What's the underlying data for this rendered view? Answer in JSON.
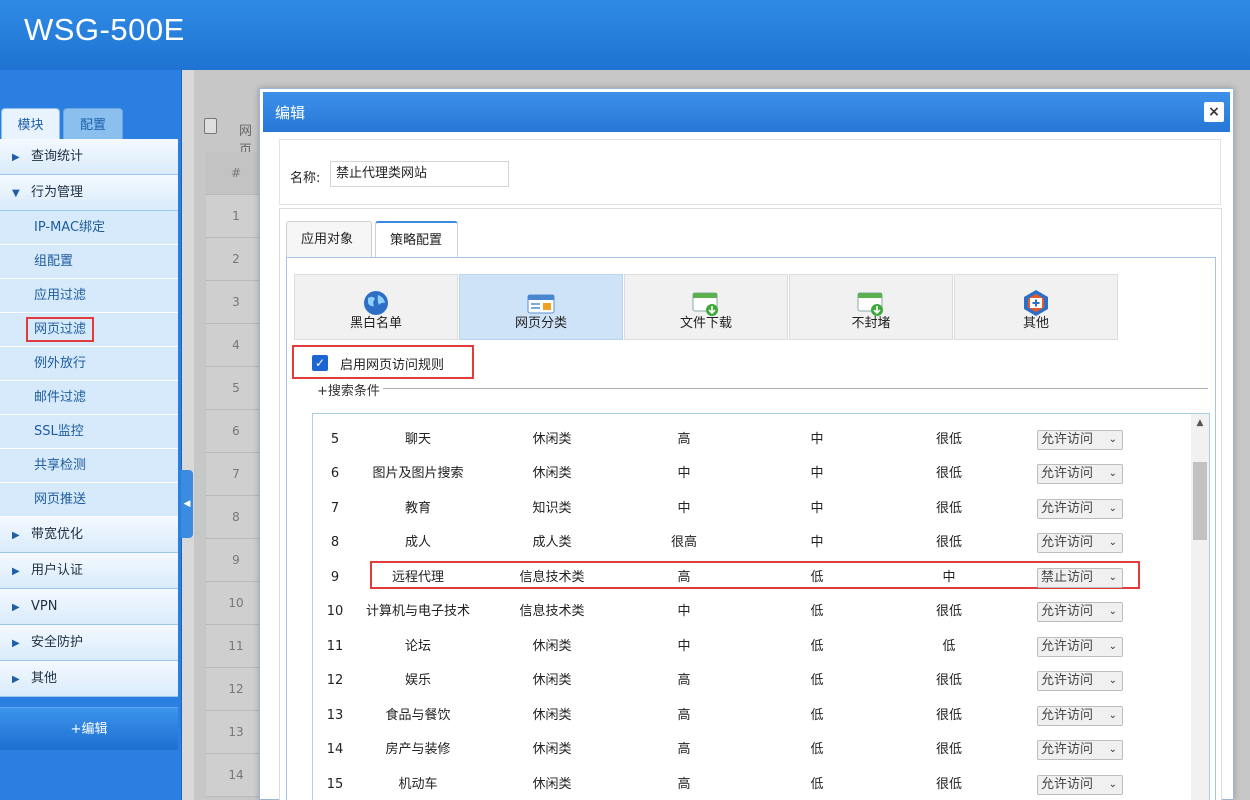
{
  "header": {
    "product": "WSG-500E"
  },
  "sidebar": {
    "tabs": [
      "模块",
      "配置"
    ],
    "menu": [
      {
        "label": "查询统计",
        "expanded": false
      },
      {
        "label": "行为管理",
        "expanded": true
      }
    ],
    "submenu": [
      "IP-MAC绑定",
      "组配置",
      "应用过滤",
      "网页过滤",
      "例外放行",
      "邮件过滤",
      "SSL监控",
      "共享检测",
      "网页推送"
    ],
    "menu_rest": [
      "带宽优化",
      "用户认证",
      "VPN",
      "安全防护",
      "其他"
    ],
    "edit_button": "+编辑",
    "active_submenu": "网页过滤"
  },
  "background": {
    "toolbar_text": "网页",
    "head": "#",
    "rows": [
      "1",
      "2",
      "3",
      "4",
      "5",
      "6",
      "7",
      "8",
      "9",
      "10",
      "11",
      "12",
      "13",
      "14"
    ]
  },
  "modal": {
    "title": "编辑",
    "close": "×",
    "name_label": "名称:",
    "name_value": "禁止代理类网站",
    "tabs": [
      "应用对象",
      "策略配置"
    ],
    "active_tab": "策略配置",
    "categories": [
      {
        "label": "黑白名单",
        "icon": "globe-icon"
      },
      {
        "label": "网页分类",
        "icon": "webpage-category-icon",
        "selected": true
      },
      {
        "label": "文件下载",
        "icon": "file-download-icon"
      },
      {
        "label": "不封堵",
        "icon": "no-block-icon"
      },
      {
        "label": "其他",
        "icon": "other-plus-icon"
      }
    ],
    "enable_label": "启用网页访问规则",
    "enable_checked": true,
    "search_label": "+搜索条件",
    "rows": [
      {
        "num": "5",
        "name": "聊天",
        "cls": "休闲类",
        "r1": "高",
        "r2": "中",
        "r3": "很低",
        "action": "允许访问"
      },
      {
        "num": "6",
        "name": "图片及图片搜索",
        "cls": "休闲类",
        "r1": "中",
        "r2": "中",
        "r3": "很低",
        "action": "允许访问"
      },
      {
        "num": "7",
        "name": "教育",
        "cls": "知识类",
        "r1": "中",
        "r2": "中",
        "r3": "很低",
        "action": "允许访问"
      },
      {
        "num": "8",
        "name": "成人",
        "cls": "成人类",
        "r1": "很高",
        "r2": "中",
        "r3": "很低",
        "action": "允许访问"
      },
      {
        "num": "9",
        "name": "远程代理",
        "cls": "信息技术类",
        "r1": "高",
        "r2": "低",
        "r3": "中",
        "action": "禁止访问"
      },
      {
        "num": "10",
        "name": "计算机与电子技术",
        "cls": "信息技术类",
        "r1": "中",
        "r2": "低",
        "r3": "很低",
        "action": "允许访问"
      },
      {
        "num": "11",
        "name": "论坛",
        "cls": "休闲类",
        "r1": "中",
        "r2": "低",
        "r3": "低",
        "action": "允许访问"
      },
      {
        "num": "12",
        "name": "娱乐",
        "cls": "休闲类",
        "r1": "高",
        "r2": "低",
        "r3": "很低",
        "action": "允许访问"
      },
      {
        "num": "13",
        "name": "食品与餐饮",
        "cls": "休闲类",
        "r1": "高",
        "r2": "低",
        "r3": "很低",
        "action": "允许访问"
      },
      {
        "num": "14",
        "name": "房产与装修",
        "cls": "休闲类",
        "r1": "高",
        "r2": "低",
        "r3": "很低",
        "action": "允许访问"
      },
      {
        "num": "15",
        "name": "机动车",
        "cls": "休闲类",
        "r1": "高",
        "r2": "低",
        "r3": "很低",
        "action": "允许访问"
      }
    ],
    "highlighted_row": "9"
  },
  "colors": {
    "brand_blue": "#2a7fe0",
    "highlight_red": "#e23b3b",
    "checkbox_blue": "#1b66d3"
  }
}
